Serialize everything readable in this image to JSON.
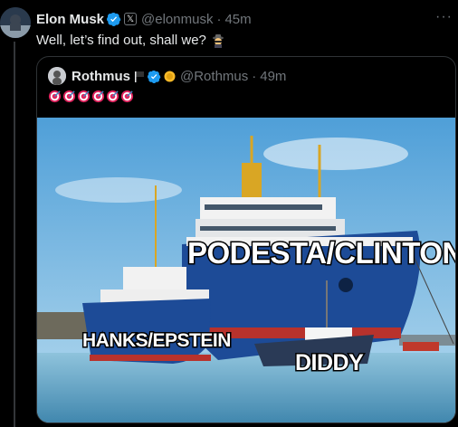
{
  "tweet": {
    "author_name": "Elon Musk",
    "handle": "@elonmusk",
    "separator": "·",
    "time": "45m",
    "text": "Well, let’s find out, shall we?",
    "more_label": "···",
    "xbadge": "𝕏"
  },
  "quoted": {
    "author_name": "Rothmus",
    "handle": "@Rothmus",
    "separator": "·",
    "time": "49m",
    "target_emoji_count": 6
  },
  "meme": {
    "label_large_ship": "PODESTA/CLINTON",
    "label_small_ship": "HANKS/EPSTEIN",
    "label_tiny_boat": "DIDDY"
  },
  "colors": {
    "verified_blue": "#1d9bf0",
    "muted_text": "#71767b",
    "border": "#2f3336",
    "coin_gold": "#f7b928"
  },
  "icons": [
    "verified-badge-icon",
    "x-badge-icon",
    "spy-emoji-icon",
    "flag-icon",
    "gold-coin-icon",
    "target-emoji-icon"
  ]
}
